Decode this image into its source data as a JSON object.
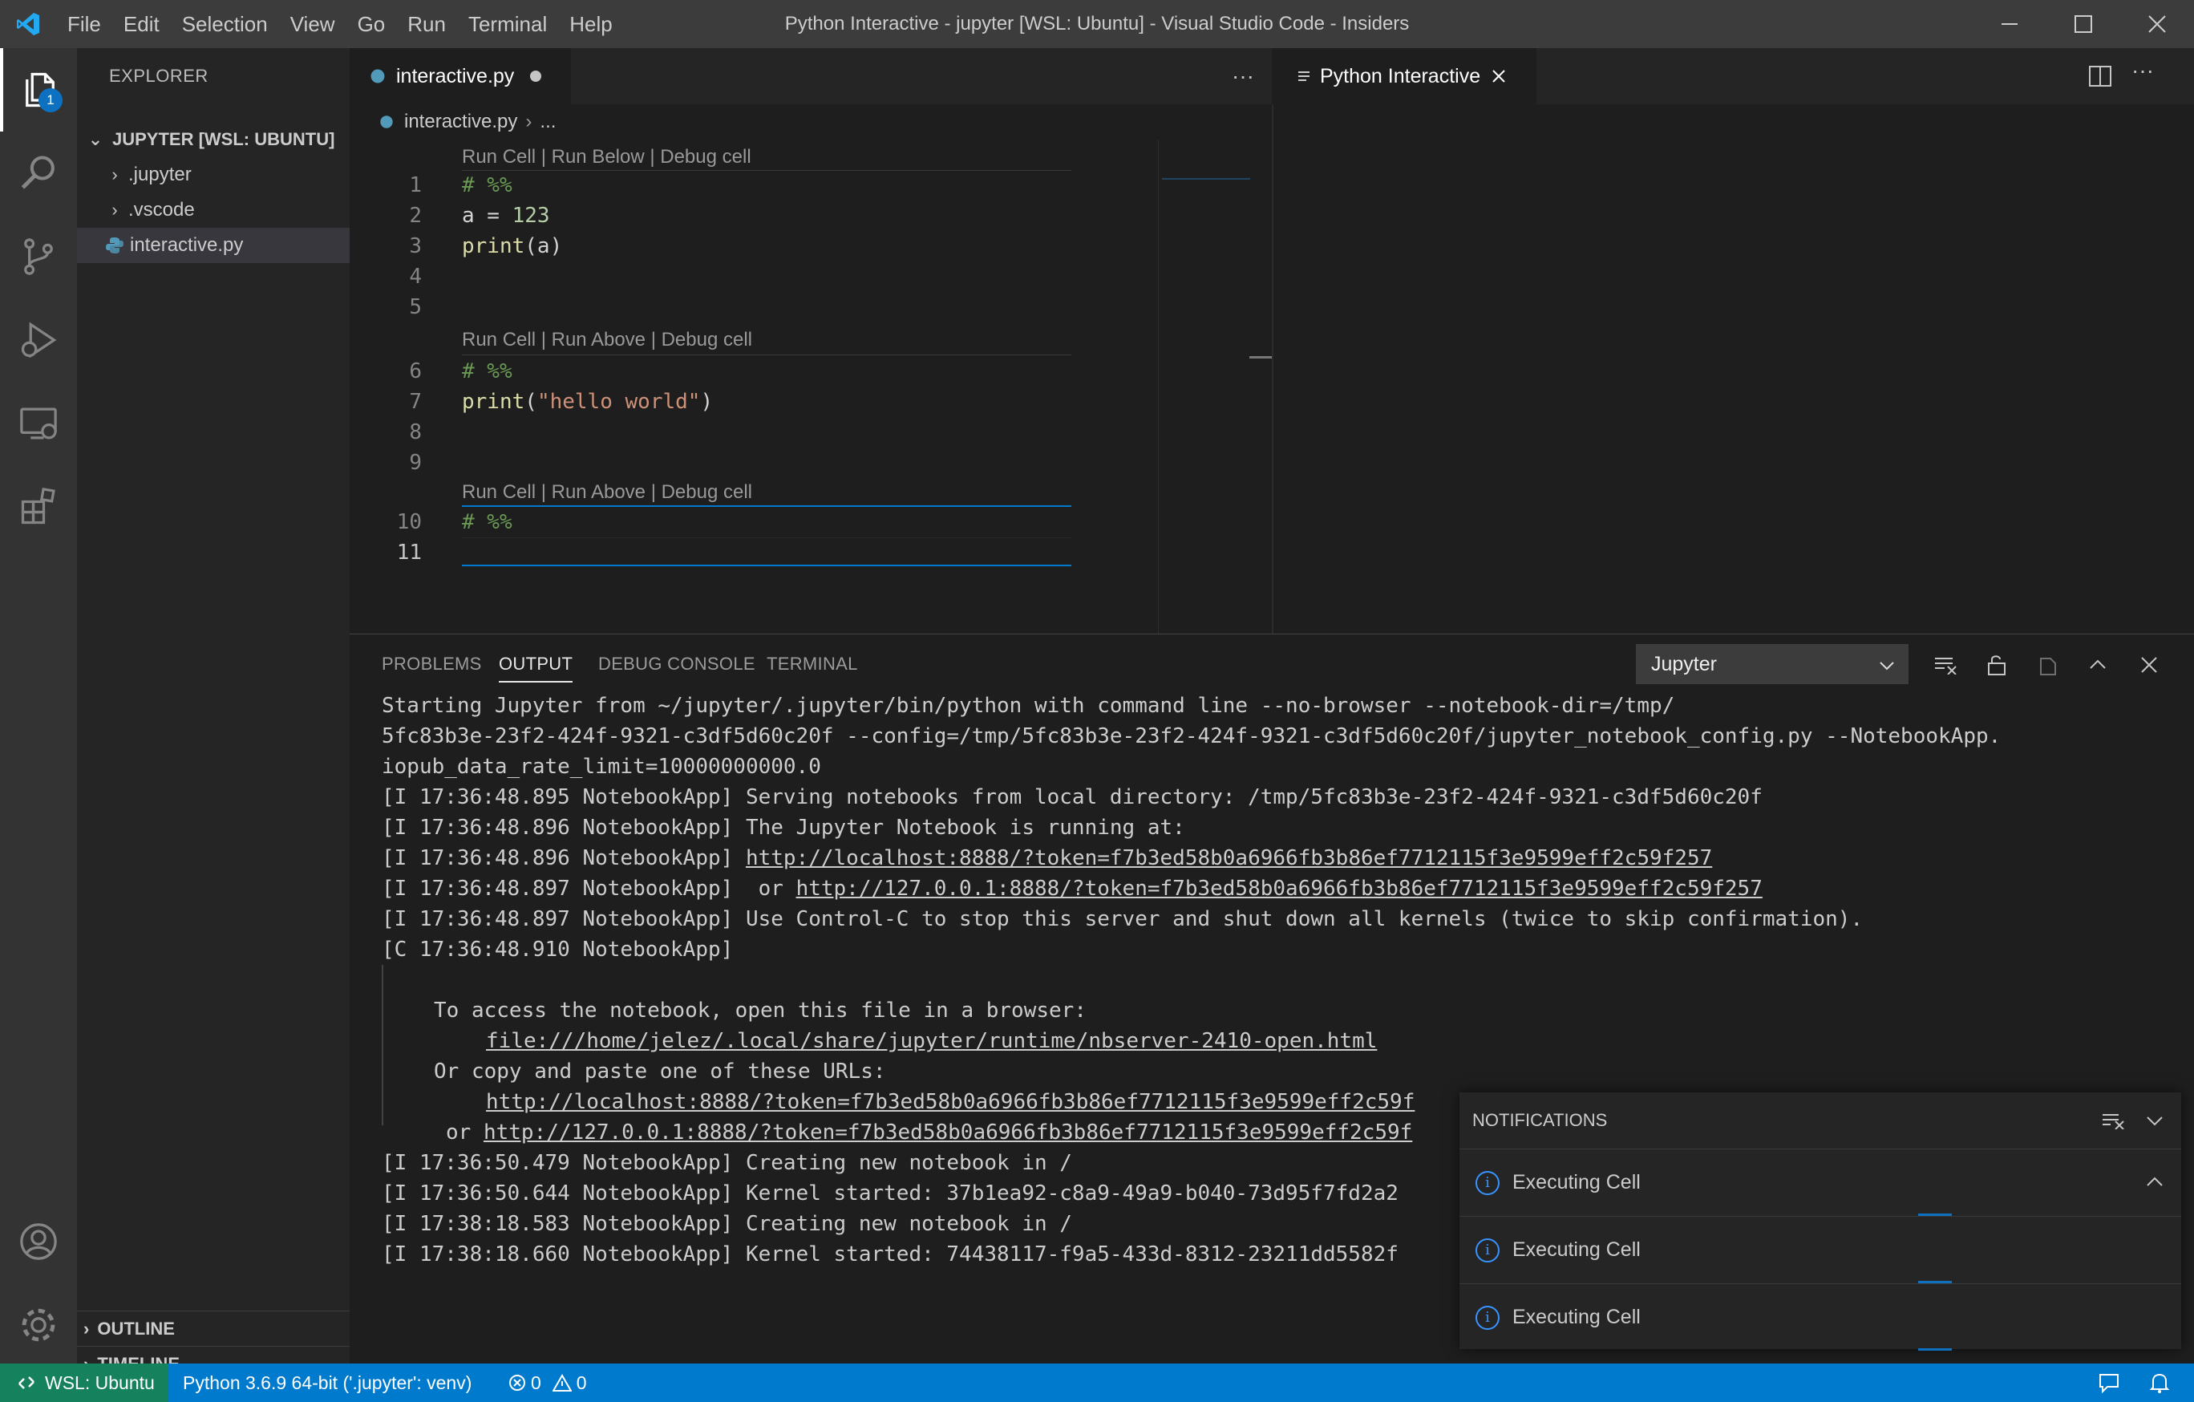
{
  "window": {
    "title": "Python Interactive - jupyter [WSL: Ubuntu] - Visual Studio Code - Insiders"
  },
  "menu": [
    "File",
    "Edit",
    "Selection",
    "View",
    "Go",
    "Run",
    "Terminal",
    "Help"
  ],
  "activity": {
    "explorer_badge": "1"
  },
  "sidebar": {
    "header": "EXPLORER",
    "root": "JUPYTER [WSL: UBUNTU]",
    "items": [
      {
        "label": ".jupyter"
      },
      {
        "label": ".vscode"
      },
      {
        "label": "interactive.py"
      }
    ],
    "outline": "OUTLINE",
    "timeline": "TIMELINE"
  },
  "editor": {
    "tab_label": "interactive.py",
    "more": "···",
    "breadcrumb_file": "interactive.py",
    "breadcrumb_rest": "...",
    "lens1": "Run Cell | Run Below | Debug cell",
    "lens2": "Run Cell | Run Above | Debug cell",
    "lens3": "Run Cell | Run Above | Debug cell",
    "line_numbers": [
      "1",
      "2",
      "3",
      "4",
      "5",
      "6",
      "7",
      "8",
      "9",
      "10",
      "11"
    ],
    "code": {
      "l1": "# %%",
      "l2_a": "a = ",
      "l2_num": "123",
      "l3_fn": "print",
      "l3_rest": "(a)",
      "l6": "# %%",
      "l7_fn": "print",
      "l7_open": "(",
      "l7_str": "\"hello world\"",
      "l7_close": ")",
      "l10": "# %%"
    }
  },
  "interactive": {
    "tab_label": "Python Interactive"
  },
  "panel": {
    "tabs": [
      "PROBLEMS",
      "OUTPUT",
      "DEBUG CONSOLE",
      "TERMINAL"
    ],
    "channel": "Jupyter",
    "output": [
      "Starting Jupyter from ~/jupyter/.jupyter/bin/python with command line --no-browser --notebook-dir=/tmp/",
      "5fc83b3e-23f2-424f-9321-c3df5d60c20f --config=/tmp/5fc83b3e-23f2-424f-9321-c3df5d60c20f/jupyter_notebook_config.py --NotebookApp.",
      "iopub_data_rate_limit=10000000000.0",
      "[I 17:36:48.895 NotebookApp] Serving notebooks from local directory: /tmp/5fc83b3e-23f2-424f-9321-c3df5d60c20f",
      "[I 17:36:48.896 NotebookApp] The Jupyter Notebook is running at:",
      "[I 17:36:48.896 NotebookApp] ",
      "http://localhost:8888/?token=f7b3ed58b0a6966fb3b86ef7712115f3e9599eff2c59f257",
      "[I 17:36:48.897 NotebookApp]  or ",
      "http://127.0.0.1:8888/?token=f7b3ed58b0a6966fb3b86ef7712115f3e9599eff2c59f257",
      "[I 17:36:48.897 NotebookApp] Use Control-C to stop this server and shut down all kernels (twice to skip confirmation).",
      "[C 17:36:48.910 NotebookApp]",
      "To access the notebook, open this file in a browser:",
      "file:///home/jelez/.local/share/jupyter/runtime/nbserver-2410-open.html",
      "Or copy and paste one of these URLs:",
      "http://localhost:8888/?token=f7b3ed58b0a6966fb3b86ef7712115f3e9599eff2c59f",
      "or ",
      "http://127.0.0.1:8888/?token=f7b3ed58b0a6966fb3b86ef7712115f3e9599eff2c59f",
      "[I 17:36:50.479 NotebookApp] Creating new notebook in /",
      "[I 17:36:50.644 NotebookApp] Kernel started: 37b1ea92-c8a9-49a9-b040-73d95f7fd2a2",
      "[I 17:38:18.583 NotebookApp] Creating new notebook in /",
      "[I 17:38:18.660 NotebookApp] Kernel started: 74438117-f9a5-433d-8312-23211dd5582f"
    ]
  },
  "notifications": {
    "header": "NOTIFICATIONS",
    "items": [
      {
        "label": "Executing Cell"
      },
      {
        "label": "Executing Cell"
      },
      {
        "label": "Executing Cell"
      }
    ]
  },
  "status": {
    "remote": "WSL: Ubuntu",
    "interpreter": "Python 3.6.9 64-bit ('.jupyter': venv)",
    "errors": "0",
    "warnings": "0"
  },
  "colors": {
    "accent": "#007acc",
    "remote": "#16825d",
    "comment": "#6a9955",
    "string": "#ce9178",
    "function": "#dcdcaa",
    "number": "#b5cea8"
  }
}
